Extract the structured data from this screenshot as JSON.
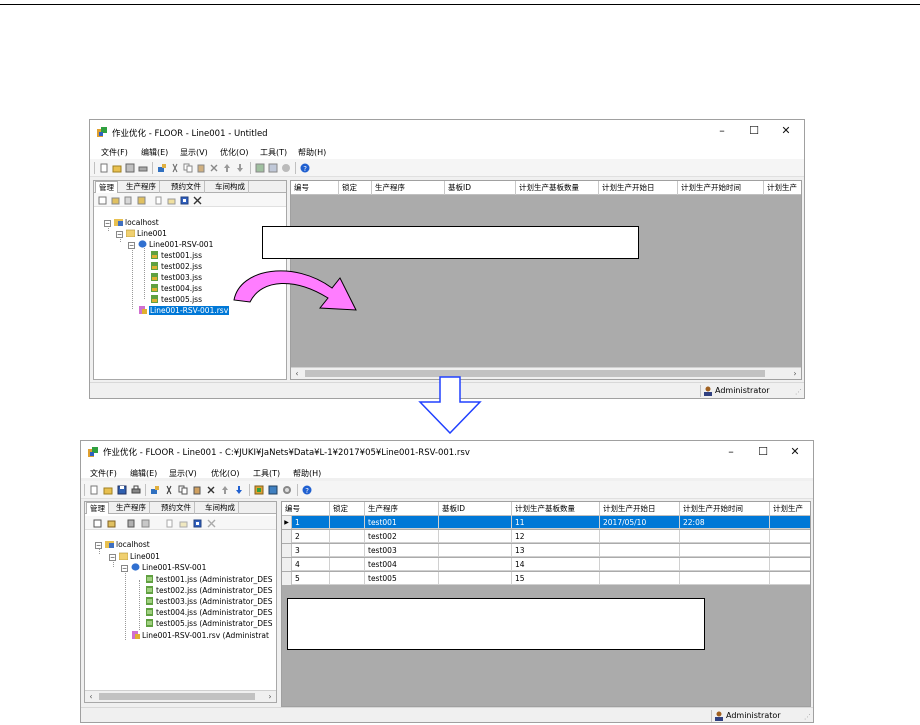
{
  "top_window": {
    "title": "作业优化 - FLOOR - Line001 - Untitled",
    "menu": [
      "文件(F)",
      "编辑(E)",
      "显示(V)",
      "优化(O)",
      "工具(T)",
      "帮助(H)"
    ],
    "tabs": [
      "管理",
      "生产程序",
      "预约文件",
      "车间构成"
    ],
    "tree": {
      "root": "localhost",
      "line": "Line001",
      "rsv": "Line001-RSV-001",
      "files": [
        "test001.jss",
        "test002.jss",
        "test003.jss",
        "test004.jss",
        "test005.jss"
      ],
      "selected_item": "Line001-RSV-001.rsv"
    },
    "grid_columns": [
      "编号",
      "锁定",
      "生产程序",
      "基板ID",
      "计划生产基板数量",
      "计划生产开始日",
      "计划生产开始时间",
      "计划生产"
    ],
    "status_user": "Administrator"
  },
  "bottom_window": {
    "title": "作业优化 - FLOOR - Line001 - C:¥JUKI¥JaNets¥Data¥L-1¥2017¥05¥Line001-RSV-001.rsv",
    "menu": [
      "文件(F)",
      "编辑(E)",
      "显示(V)",
      "优化(O)",
      "工具(T)",
      "帮助(H)"
    ],
    "tabs": [
      "管理",
      "生产程序",
      "预约文件",
      "车间构成"
    ],
    "tree": {
      "root": "localhost",
      "line": "Line001",
      "rsv": "Line001-RSV-001",
      "files": [
        "test001.jss (Administrator_DES",
        "test002.jss (Administrator_DES",
        "test003.jss (Administrator_DES",
        "test004.jss (Administrator_DES",
        "test005.jss (Administrator_DES"
      ],
      "rsv_file": "Line001-RSV-001.rsv (Administrat"
    },
    "grid_columns": [
      "编号",
      "锁定",
      "生产程序",
      "基板ID",
      "计划生产基板数量",
      "计划生产开始日",
      "计划生产开始时间",
      "计划生产"
    ],
    "grid_rows": [
      {
        "no": "1",
        "lock": "",
        "program": "test001",
        "board_id": "",
        "qty": "11",
        "start_date": "2017/05/10",
        "start_time": "22:08"
      },
      {
        "no": "2",
        "lock": "",
        "program": "test002",
        "board_id": "",
        "qty": "12",
        "start_date": "",
        "start_time": ""
      },
      {
        "no": "3",
        "lock": "",
        "program": "test003",
        "board_id": "",
        "qty": "13",
        "start_date": "",
        "start_time": ""
      },
      {
        "no": "4",
        "lock": "",
        "program": "test004",
        "board_id": "",
        "qty": "14",
        "start_date": "",
        "start_time": ""
      },
      {
        "no": "5",
        "lock": "",
        "program": "test005",
        "board_id": "",
        "qty": "15",
        "start_date": "",
        "start_time": ""
      }
    ],
    "status_user": "Administrator"
  },
  "colors": {
    "selection": "#0078d7",
    "grid_empty": "#ababab",
    "drag_arrow": "#ff40ff",
    "flow_arrow": "#3050ff"
  }
}
